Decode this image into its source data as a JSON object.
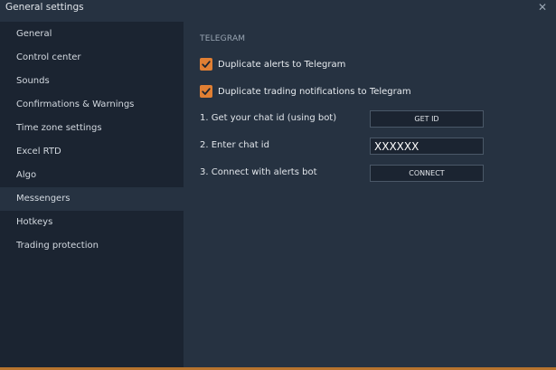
{
  "window": {
    "title": "General settings",
    "close_glyph": "✕"
  },
  "sidebar": {
    "items": [
      {
        "label": "General"
      },
      {
        "label": "Control center"
      },
      {
        "label": "Sounds"
      },
      {
        "label": "Confirmations & Warnings"
      },
      {
        "label": "Time zone settings"
      },
      {
        "label": "Excel RTD"
      },
      {
        "label": "Algo"
      },
      {
        "label": "Messengers",
        "active": true
      },
      {
        "label": "Hotkeys"
      },
      {
        "label": "Trading protection"
      }
    ]
  },
  "telegram": {
    "section_title": "TELEGRAM",
    "options": [
      {
        "label": "Duplicate alerts to Telegram",
        "checked": true
      },
      {
        "label": "Duplicate trading notifications to Telegram",
        "checked": true
      }
    ],
    "step1_label": "1. Get your chat id (using bot)",
    "get_id_button": "GET ID",
    "step2_label": "2. Enter chat id",
    "chat_id_value": "XXXXXX",
    "step3_label": "3. Connect with alerts bot",
    "connect_button": "CONNECT"
  },
  "colors": {
    "accent": "#e07f33",
    "window_bg": "#263241",
    "sidebar_bg": "#1b2431"
  }
}
